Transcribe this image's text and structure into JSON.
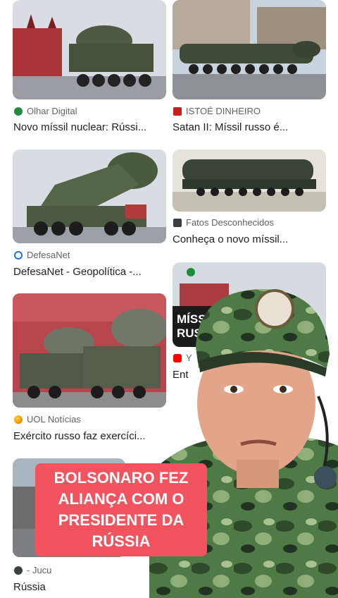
{
  "results": [
    {
      "source": "Olhar Digital",
      "title": "Novo míssil nuclear: Rússi...",
      "icon": "olhar-digital-logo-icon",
      "icon_color": "#1e8e3e"
    },
    {
      "source": "ISTOÉ DINHEIRO",
      "title": "Satan II: Míssil russo é...",
      "icon": "istoe-logo-icon",
      "icon_color": "#c5221f"
    },
    {
      "source": "DefesaNet",
      "title": "DefesaNet - Geopolítica -...",
      "icon": "defesanet-logo-icon",
      "icon_color": "#1a73e8"
    },
    {
      "source": "Fatos Desconhecidos",
      "title": "Conheça o novo míssil...",
      "icon": "fatos-desconhecidos-logo-icon",
      "icon_color": "#3c4043"
    },
    {
      "source": "UOL Notícias",
      "title": "Exército russo faz exercíci...",
      "icon": "uol-logo-icon",
      "icon_color": "#f29900"
    },
    {
      "source": "Y",
      "title": "Ent",
      "icon": "youtube-logo-icon",
      "icon_color": "#ff0000"
    },
    {
      "source": "- Jucu",
      "title": "Rússia",
      "icon": "jucu-logo-icon",
      "icon_color": "#3c4043"
    }
  ],
  "thumbnail_text": {
    "missil_line1": "MÍSSIL",
    "missil_line2": "RUSS"
  },
  "caption": {
    "line1": "BOLSONARO FEZ",
    "line2": "ALIANÇA COM O",
    "line3": "PRESIDENTE DA",
    "line4": "RÚSSIA",
    "background": "#f2545f"
  }
}
